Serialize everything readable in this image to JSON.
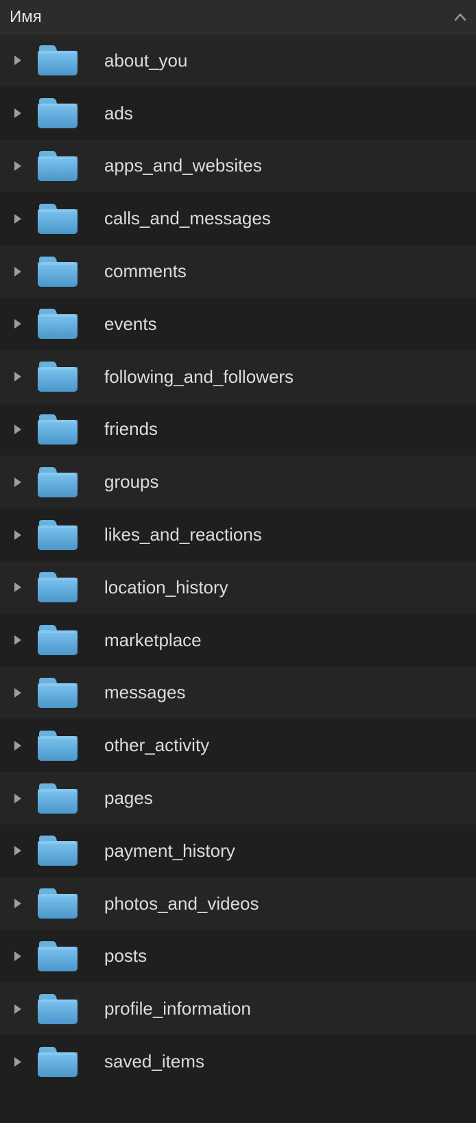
{
  "header": {
    "column_label": "Имя",
    "sort_direction": "asc"
  },
  "colors": {
    "folder_top": "#6db7e6",
    "folder_bottom": "#4e9ed3",
    "row_odd": "#252525",
    "row_even": "#1f1f1f",
    "arrow": "#9e9e9e",
    "text": "#dcdcdc"
  },
  "folders": [
    {
      "name": "about_you",
      "type": "folder",
      "expanded": false
    },
    {
      "name": "ads",
      "type": "folder",
      "expanded": false
    },
    {
      "name": "apps_and_websites",
      "type": "folder",
      "expanded": false
    },
    {
      "name": "calls_and_messages",
      "type": "folder",
      "expanded": false
    },
    {
      "name": "comments",
      "type": "folder",
      "expanded": false
    },
    {
      "name": "events",
      "type": "folder",
      "expanded": false
    },
    {
      "name": "following_and_followers",
      "type": "folder",
      "expanded": false
    },
    {
      "name": "friends",
      "type": "folder",
      "expanded": false
    },
    {
      "name": "groups",
      "type": "folder",
      "expanded": false
    },
    {
      "name": "likes_and_reactions",
      "type": "folder",
      "expanded": false
    },
    {
      "name": "location_history",
      "type": "folder",
      "expanded": false
    },
    {
      "name": "marketplace",
      "type": "folder",
      "expanded": false
    },
    {
      "name": "messages",
      "type": "folder",
      "expanded": false
    },
    {
      "name": "other_activity",
      "type": "folder",
      "expanded": false
    },
    {
      "name": "pages",
      "type": "folder",
      "expanded": false
    },
    {
      "name": "payment_history",
      "type": "folder",
      "expanded": false
    },
    {
      "name": "photos_and_videos",
      "type": "folder",
      "expanded": false
    },
    {
      "name": "posts",
      "type": "folder",
      "expanded": false
    },
    {
      "name": "profile_information",
      "type": "folder",
      "expanded": false
    },
    {
      "name": "saved_items",
      "type": "folder",
      "expanded": false
    }
  ]
}
